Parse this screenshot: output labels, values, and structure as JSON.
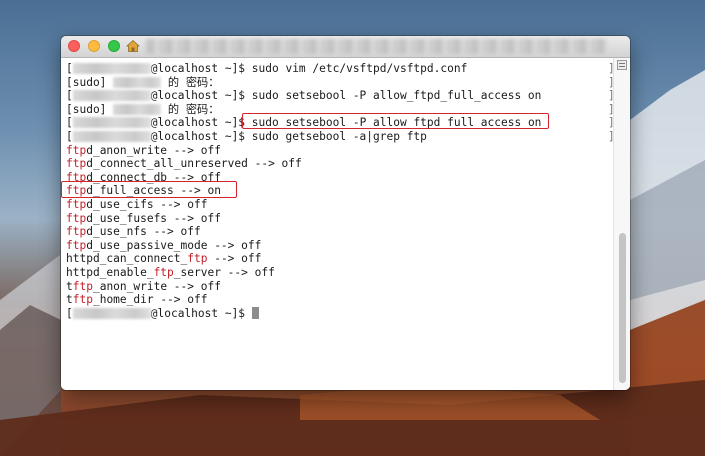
{
  "terminal": {
    "lines": [
      {
        "user_blurred": true,
        "segments": [
          {
            "text": "@localhost ~]$ sudo vim /etc/vsftpd/vsftpd.conf",
            "red": false
          }
        ]
      },
      {
        "sudo_prompt": true,
        "segments": [
          {
            "text": "[sudo] ",
            "red": false
          },
          {
            "text": " 的 密码：",
            "red": false
          }
        ]
      },
      {
        "user_blurred": true,
        "segments": [
          {
            "text": "@localhost ~]$ sudo setsebool -P allow_ftpd_full_access on",
            "red": false
          }
        ]
      },
      {
        "sudo_prompt": true,
        "segments": [
          {
            "text": "[sudo] ",
            "red": false
          },
          {
            "text": " 的 密码：",
            "red": false
          }
        ]
      },
      {
        "user_blurred": true,
        "segments": [
          {
            "text": "@localhost ~]$ ",
            "red": false
          },
          {
            "text": "sudo setsebool -P allow_ftpd_full_access on",
            "red": false
          }
        ]
      },
      {
        "user_blurred": true,
        "segments": [
          {
            "text": "@localhost ~]$ sudo getsebool -a|grep ftp",
            "red": false
          }
        ]
      },
      {
        "segments": [
          {
            "text": "ftp",
            "red": true
          },
          {
            "text": "d_anon_write --> off",
            "red": false
          }
        ]
      },
      {
        "segments": [
          {
            "text": "ftp",
            "red": true
          },
          {
            "text": "d_connect_all_unreserved --> off",
            "red": false
          }
        ]
      },
      {
        "segments": [
          {
            "text": "ftp",
            "red": true
          },
          {
            "text": "d_connect_db --> off",
            "red": false
          }
        ]
      },
      {
        "segments": [
          {
            "text": "ftp",
            "red": true
          },
          {
            "text": "d_full_access --> on",
            "red": false
          }
        ]
      },
      {
        "segments": [
          {
            "text": "ftp",
            "red": true
          },
          {
            "text": "d_use_cifs --> off",
            "red": false
          }
        ]
      },
      {
        "segments": [
          {
            "text": "ftp",
            "red": true
          },
          {
            "text": "d_use_fusefs --> off",
            "red": false
          }
        ]
      },
      {
        "segments": [
          {
            "text": "ftp",
            "red": true
          },
          {
            "text": "d_use_nfs --> off",
            "red": false
          }
        ]
      },
      {
        "segments": [
          {
            "text": "ftp",
            "red": true
          },
          {
            "text": "d_use_passive_mode --> off",
            "red": false
          }
        ]
      },
      {
        "segments": [
          {
            "text": "httpd_can_connect_",
            "red": false
          },
          {
            "text": "ftp",
            "red": true
          },
          {
            "text": " --> off",
            "red": false
          }
        ]
      },
      {
        "segments": [
          {
            "text": "httpd_enable_",
            "red": false
          },
          {
            "text": "ftp",
            "red": true
          },
          {
            "text": "_server --> off",
            "red": false
          }
        ]
      },
      {
        "segments": [
          {
            "text": "t",
            "red": false
          },
          {
            "text": "ftp",
            "red": true
          },
          {
            "text": "_anon_write --> off",
            "red": false
          }
        ]
      },
      {
        "segments": [
          {
            "text": "t",
            "red": false
          },
          {
            "text": "ftp",
            "red": true
          },
          {
            "text": "_home_dir --> off",
            "red": false
          }
        ]
      },
      {
        "user_blurred": true,
        "cursor": true,
        "segments": [
          {
            "text": "@localhost ~]$ ",
            "red": false
          }
        ]
      }
    ]
  },
  "colors": {
    "highlight_box": "#d4252d",
    "keyword": "#c2202a",
    "close": "#fc605c",
    "minimize": "#fdbc40",
    "maximize": "#34c84a"
  },
  "icons": [
    "close-icon",
    "minimize-icon",
    "maximize-icon",
    "home-folder-icon",
    "scrollbar-menu-icon"
  ]
}
